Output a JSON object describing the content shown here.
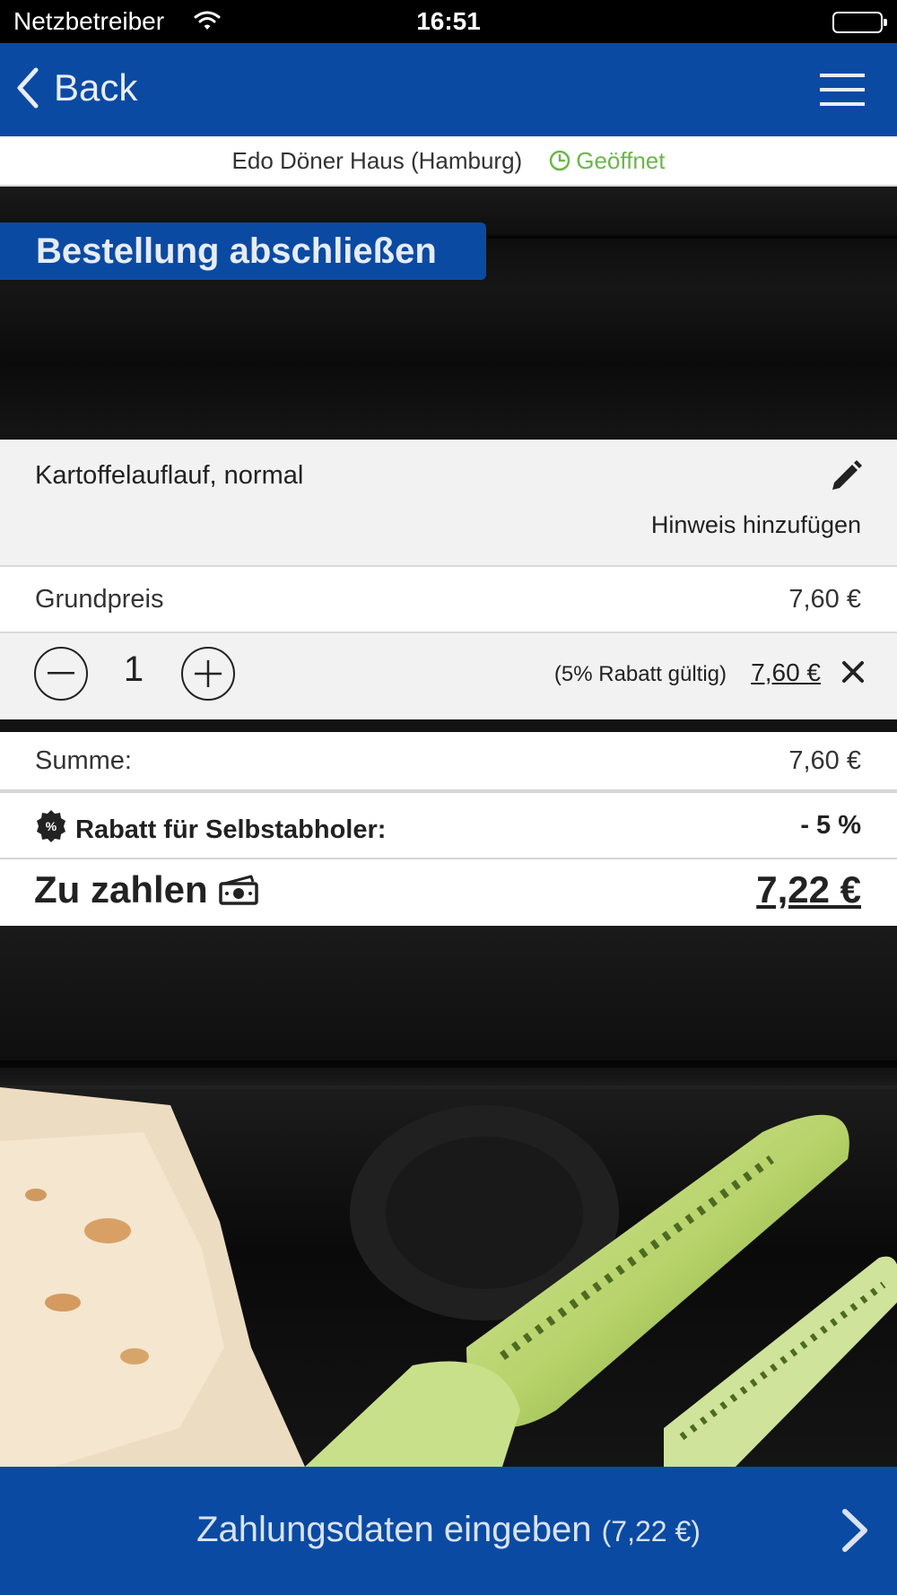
{
  "status_bar": {
    "carrier": "Netzbetreiber",
    "time": "16:51",
    "battery_level": 1.0
  },
  "nav": {
    "back_label": "Back",
    "back_icon": "chevron-left-icon",
    "menu_icon": "hamburger-menu-icon"
  },
  "restaurant": {
    "name": "Edo Döner Haus (Hamburg)",
    "status": "Geöffnet",
    "status_color": "#6bb64a"
  },
  "page_title": "Bestellung abschließen",
  "item": {
    "name": "Kartoffelauflauf, normal",
    "note_label": "Hinweis hinzufügen",
    "base_label": "Grundpreis",
    "base_price": "7,60 €",
    "quantity": "1",
    "discount_note": "(5% Rabatt gültig)",
    "line_price": "7,60 €"
  },
  "summary": {
    "sum_label": "Summe:",
    "sum_value": "7,60 €",
    "rabatt_icon_text": "%",
    "rabatt_label": "Rabatt für Selbstabholer:",
    "rabatt_value": "- 5 %",
    "pay_label": "Zu zahlen",
    "pay_value": "7,22 €"
  },
  "cta": {
    "label": "Zahlungsdaten eingeben",
    "amount": "(7,22 €)"
  },
  "colors": {
    "brand_blue": "#0b4aa2",
    "row_grey": "#f2f2f2"
  }
}
